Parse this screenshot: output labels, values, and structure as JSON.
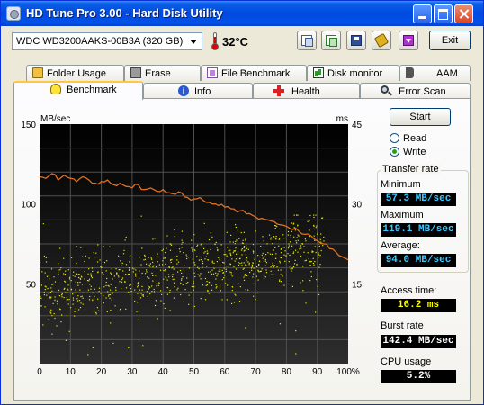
{
  "window": {
    "title": "HD Tune Pro 3.00 - Hard Disk Utility"
  },
  "toolbar": {
    "drive": "WDC WD3200AAKS-00B3A (320 GB)",
    "temperature": "32°C",
    "exit_label": "Exit"
  },
  "tabs_top": [
    {
      "label": "Folder Usage",
      "icon": "folder-icon"
    },
    {
      "label": "Erase",
      "icon": "trash-icon"
    },
    {
      "label": "File Benchmark",
      "icon": "file-icon"
    },
    {
      "label": "Disk monitor",
      "icon": "graph-icon"
    },
    {
      "label": "AAM",
      "icon": "speaker-icon"
    }
  ],
  "tabs_bottom": [
    {
      "label": "Benchmark",
      "icon": "bulb-icon",
      "active": true
    },
    {
      "label": "Info",
      "icon": "info-icon"
    },
    {
      "label": "Health",
      "icon": "cross-icon"
    },
    {
      "label": "Error Scan",
      "icon": "magnifier-icon"
    }
  ],
  "controls": {
    "start_label": "Start",
    "read_label": "Read",
    "write_label": "Write",
    "selected_mode": "write"
  },
  "results": {
    "group_title": "Transfer rate",
    "minimum_label": "Minimum",
    "minimum_value": "57.3 MB/sec",
    "maximum_label": "Maximum",
    "maximum_value": "119.1 MB/sec",
    "average_label": "Average:",
    "average_value": "94.0 MB/sec",
    "access_label": "Access time:",
    "access_value": "16.2 ms",
    "burst_label": "Burst rate",
    "burst_value": "142.4 MB/sec",
    "cpu_label": "CPU usage",
    "cpu_value": "5.2%"
  },
  "chart_data": {
    "type": "line",
    "left_unit": "MB/sec",
    "right_unit": "ms",
    "left_ticks": [
      "150",
      "100",
      "50"
    ],
    "right_ticks": [
      "45",
      "30",
      "15"
    ],
    "x_ticks": [
      "0",
      "10",
      "20",
      "30",
      "40",
      "50",
      "60",
      "70",
      "80",
      "90",
      "100%"
    ],
    "x": [
      0,
      2,
      4,
      6,
      8,
      10,
      12,
      14,
      16,
      18,
      20,
      22,
      24,
      26,
      28,
      30,
      32,
      34,
      36,
      38,
      40,
      42,
      44,
      46,
      48,
      50,
      52,
      54,
      56,
      58,
      60,
      62,
      64,
      66,
      68,
      70,
      72,
      74,
      76,
      78,
      80,
      82,
      84,
      86,
      88,
      90,
      92,
      94,
      96,
      98,
      100
    ],
    "series": [
      {
        "values": [
          117,
          116,
          119,
          115,
          118,
          116,
          114,
          117,
          115,
          113,
          114,
          115,
          112,
          113,
          111,
          110,
          112,
          109,
          110,
          108,
          109,
          107,
          106,
          107,
          104,
          103,
          104,
          101,
          100,
          99,
          98,
          97,
          95,
          96,
          94,
          92,
          91,
          90,
          89,
          87,
          86,
          84,
          83,
          81,
          80,
          77,
          75,
          72,
          70,
          67,
          65
        ]
      }
    ],
    "access_time": {
      "axis": "right",
      "min_ms": 1,
      "max_ms": 28,
      "typical_start_ms": 13,
      "typical_end_ms": 22
    },
    "ylim": [
      0,
      150
    ],
    "y2lim": [
      0,
      45
    ],
    "xlim": [
      0,
      100
    ],
    "grid": true,
    "colors": {
      "background": "#000000",
      "line": "#e07020",
      "points": "#e8e800",
      "grid": "#505050",
      "axis_text": "#000000"
    }
  }
}
